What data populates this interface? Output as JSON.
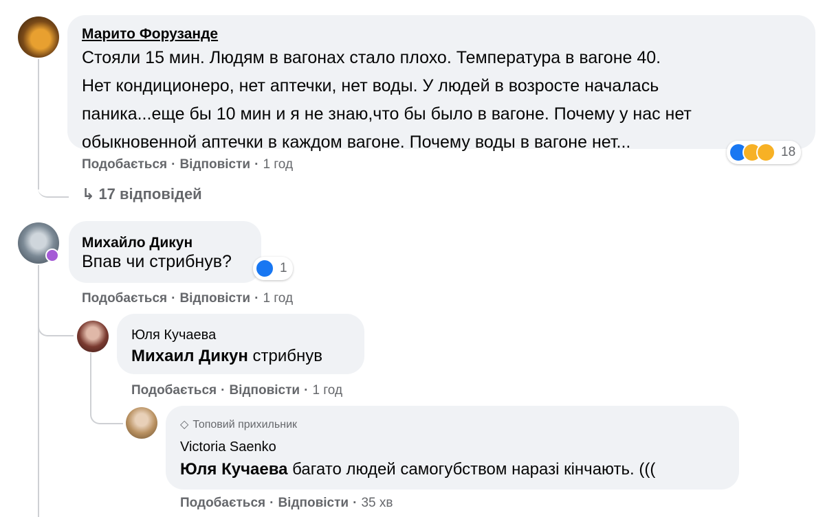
{
  "colors": {
    "bubble": "#f0f2f5",
    "meta": "#65676b",
    "like": "#1877f2",
    "haha": "#f7b125",
    "line": "#ced0d4"
  },
  "comment1": {
    "author": "Марито Форузанде",
    "lines": [
      "Стояли 15 мин. Людям в вагонах стало плохо. Температура в вагоне 40.",
      "Нет кондиционеро, нет аптечки, нет воды. У людей в возросте началась",
      "паника...еще бы 10 мин и я не знаю,что бы было в вагоне. Почему у нас нет",
      "обыкновенной аптечки в каждом вагоне. Почему воды в вагоне нет..."
    ],
    "reactions": {
      "icons": [
        "like-icon",
        "haha-icon",
        "sad-icon"
      ],
      "count": "18"
    },
    "like": "Подобається",
    "reply": "Відповісти",
    "time": "1 год",
    "replies_link": "17 відповідей"
  },
  "comment2": {
    "author": "Михайло Дикун",
    "text": "Впав чи стрибнув?",
    "reactions": {
      "icons": [
        "like-icon"
      ],
      "count": "1"
    },
    "like": "Подобається",
    "reply": "Відповісти",
    "time": "1 год"
  },
  "reply1": {
    "author": "Юля Кучаева",
    "mention": "Михаил Дикун",
    "text": " стрибнув",
    "like": "Подобається",
    "reply": "Відповісти",
    "time": "1 год"
  },
  "reply2": {
    "badge": "Топовий прихильник",
    "author": "Victoria Saenko",
    "mention": "Юля Кучаева",
    "text": " багато людей самогубством наразі кінчають. (((",
    "like": "Подобається",
    "reply": "Відповісти",
    "time": "35 хв"
  }
}
